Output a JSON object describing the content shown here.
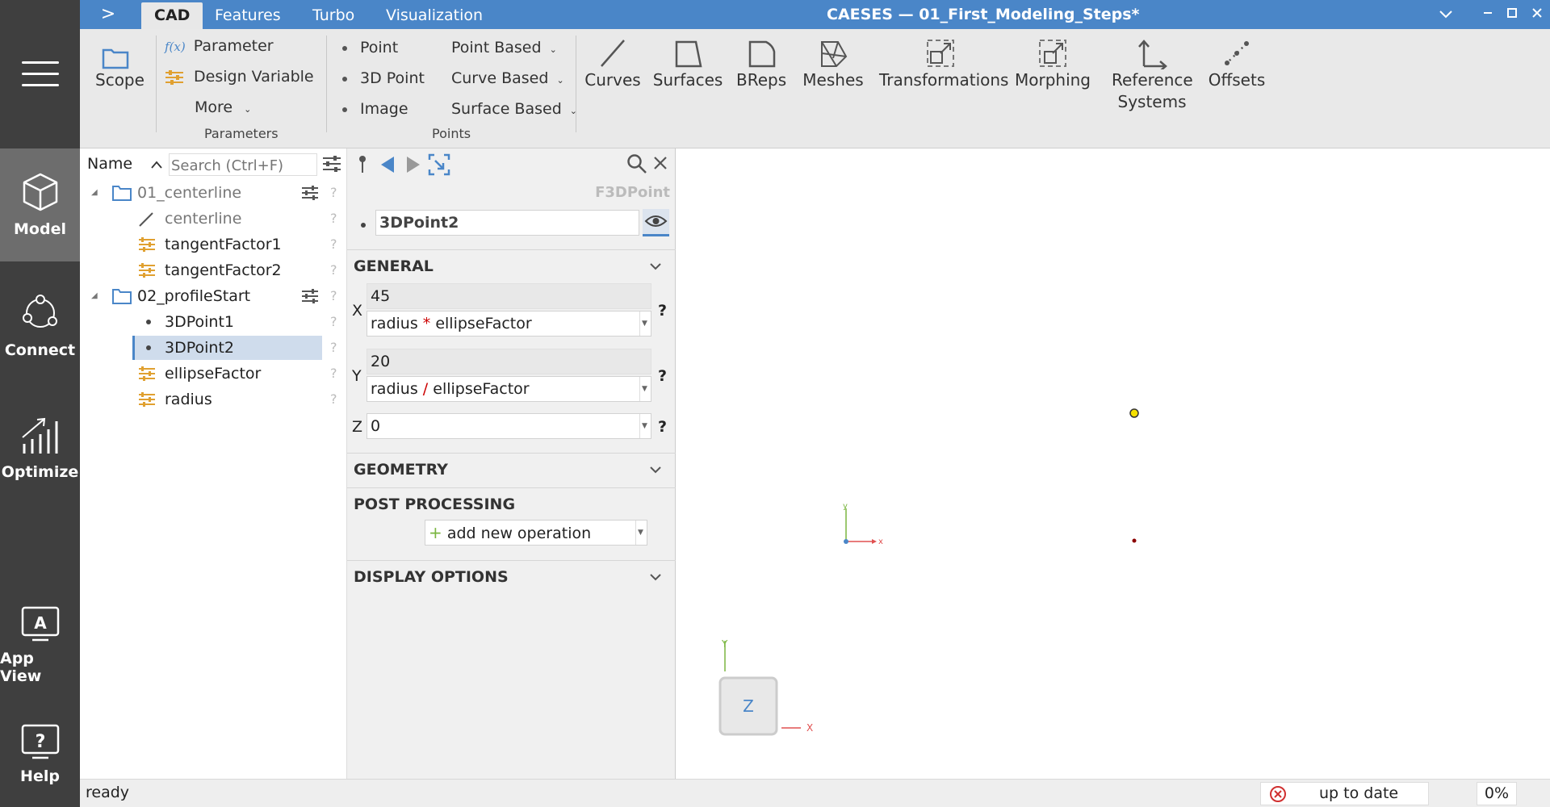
{
  "window": {
    "title": "CAESES — 01_First_Modeling_Steps*",
    "tabs": [
      "CAD",
      "Features",
      "Turbo",
      "Visualization"
    ],
    "expand_glyph": ">"
  },
  "rail": {
    "items": [
      {
        "label": "Model",
        "icon": "cube-icon"
      },
      {
        "label": "Connect",
        "icon": "connect-icon"
      },
      {
        "label": "Optimize",
        "icon": "chart-icon"
      },
      {
        "label": "App View",
        "icon": "app-view-icon"
      },
      {
        "label": "Help",
        "icon": "help-icon"
      }
    ]
  },
  "ribbon": {
    "scope": "Scope",
    "parameters": {
      "parameter": "Parameter",
      "parameter_icon_text": "f(x)",
      "design_variable": "Design Variable",
      "more": "More",
      "caption": "Parameters"
    },
    "points": {
      "point": "Point",
      "point3d": "3D Point",
      "image": "Image",
      "point_based": "Point Based",
      "curve_based": "Curve Based",
      "surface_based": "Surface Based",
      "caption": "Points"
    },
    "big_buttons": [
      "Curves",
      "Surfaces",
      "BReps",
      "Meshes",
      "Transformations",
      "Morphing",
      "Reference",
      "Systems",
      "Offsets"
    ]
  },
  "tree": {
    "header": "Name",
    "search_placeholder": "Search (Ctrl+F)",
    "rows": [
      {
        "label": "01_centerline",
        "type": "folder"
      },
      {
        "label": "centerline",
        "type": "curve"
      },
      {
        "label": "tangentFactor1",
        "type": "parameter"
      },
      {
        "label": "tangentFactor2",
        "type": "parameter"
      },
      {
        "label": "02_profileStart",
        "type": "folder"
      },
      {
        "label": "3DPoint1",
        "type": "point"
      },
      {
        "label": "3DPoint2",
        "type": "point"
      },
      {
        "label": "ellipseFactor",
        "type": "parameter"
      },
      {
        "label": "radius",
        "type": "parameter"
      }
    ],
    "help_glyph": "?"
  },
  "properties": {
    "type_label": "F3DPoint",
    "name": "3DPoint2",
    "sections": {
      "general": "GENERAL",
      "geometry": "GEOMETRY",
      "post_processing": "POST PROCESSING",
      "display_options": "DISPLAY OPTIONS"
    },
    "x": {
      "axis": "X",
      "value": "45",
      "expr_a": "radius",
      "op": "*",
      "expr_b": "ellipseFactor"
    },
    "y": {
      "axis": "Y",
      "value": "20",
      "expr_a": "radius",
      "op": "/",
      "expr_b": "ellipseFactor"
    },
    "z": {
      "axis": "Z",
      "value": "0"
    },
    "help_glyph": "?",
    "add_operation": "add new operation"
  },
  "viewport": {
    "axis_x": "x",
    "axis_y": "Y",
    "axis_y_small": "y",
    "view_cube": "Z",
    "axis_x_big": "X"
  },
  "status": {
    "text": "ready",
    "sync": "up to date",
    "progress": "0%"
  },
  "colors": {
    "accent": "#4a86c8",
    "rail": "#3f3f3f",
    "param_icon": "#e0a030",
    "point_marker": "#f5e000"
  }
}
